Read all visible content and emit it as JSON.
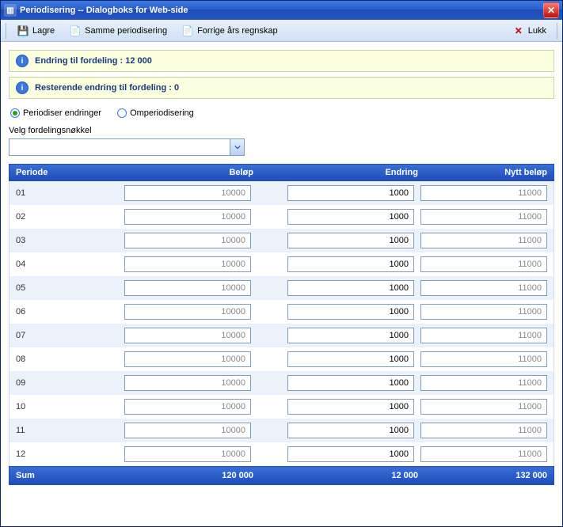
{
  "window": {
    "title": "Periodisering -- Dialogboks for Web-side"
  },
  "toolbar": {
    "save": "Lagre",
    "same": "Samme periodisering",
    "prev": "Forrige års regnskap",
    "close": "Lukk"
  },
  "info": {
    "line1": "Endring til fordeling : 12 000",
    "line2": "Resterende endring til fordeling : 0"
  },
  "radios": {
    "periodize": "Periodiser endringer",
    "reperiodize": "Omperiodisering",
    "selected": "periodize"
  },
  "combo": {
    "label": "Velg fordelingsnøkkel",
    "value": ""
  },
  "grid": {
    "headers": {
      "periode": "Periode",
      "belop": "Beløp",
      "endring": "Endring",
      "nytt": "Nytt beløp"
    },
    "rows": [
      {
        "periode": "01",
        "belop": "10000",
        "endring": "1000",
        "nytt": "11000"
      },
      {
        "periode": "02",
        "belop": "10000",
        "endring": "1000",
        "nytt": "11000"
      },
      {
        "periode": "03",
        "belop": "10000",
        "endring": "1000",
        "nytt": "11000"
      },
      {
        "periode": "04",
        "belop": "10000",
        "endring": "1000",
        "nytt": "11000"
      },
      {
        "periode": "05",
        "belop": "10000",
        "endring": "1000",
        "nytt": "11000"
      },
      {
        "periode": "06",
        "belop": "10000",
        "endring": "1000",
        "nytt": "11000"
      },
      {
        "periode": "07",
        "belop": "10000",
        "endring": "1000",
        "nytt": "11000"
      },
      {
        "periode": "08",
        "belop": "10000",
        "endring": "1000",
        "nytt": "11000"
      },
      {
        "periode": "09",
        "belop": "10000",
        "endring": "1000",
        "nytt": "11000"
      },
      {
        "periode": "10",
        "belop": "10000",
        "endring": "1000",
        "nytt": "11000"
      },
      {
        "periode": "11",
        "belop": "10000",
        "endring": "1000",
        "nytt": "11000"
      },
      {
        "periode": "12",
        "belop": "10000",
        "endring": "1000",
        "nytt": "11000"
      }
    ],
    "footer": {
      "label": "Sum",
      "belop": "120 000",
      "endring": "12 000",
      "nytt": "132 000"
    }
  }
}
